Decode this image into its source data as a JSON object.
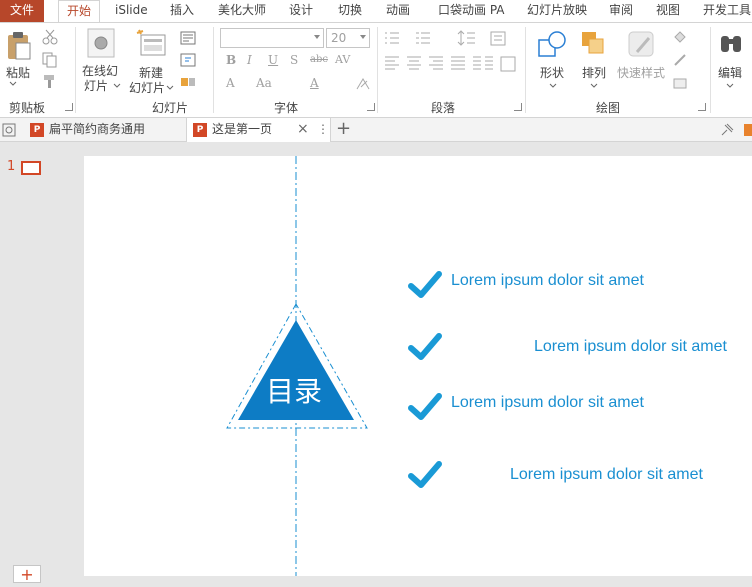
{
  "menu": {
    "file": "文件",
    "tabs": [
      "开始",
      "iSlide",
      "插入",
      "美化大师",
      "设计",
      "切换",
      "动画",
      "口袋动画 PA",
      "幻灯片放映",
      "审阅",
      "视图",
      "开发工具"
    ]
  },
  "ribbon": {
    "clipboard": {
      "paste": "粘贴",
      "label": "剪贴板"
    },
    "slides": {
      "online": "在线幻",
      "online2": "灯片",
      "new": "新建",
      "new2": "幻灯片",
      "label": "幻灯片"
    },
    "font": {
      "size": "20",
      "label": "字体",
      "bold": "B",
      "italic": "I",
      "underline": "U",
      "shadow": "S",
      "strike": "abc",
      "spacing": "AV",
      "grow": "A",
      "case": "Aa",
      "fontcolor": "A"
    },
    "paragraph": {
      "label": "段落"
    },
    "drawing": {
      "shapes": "形状",
      "arrange": "排列",
      "quickstyle": "快速样式",
      "label": "绘图"
    },
    "editing": {
      "edit": "编辑"
    }
  },
  "docs": {
    "tab1": "扁平简约商务通用",
    "tab2": "这是第一页"
  },
  "thumbs": {
    "number": "1",
    "add": "+"
  },
  "slide": {
    "title": "目录",
    "items": [
      "Lorem ipsum dolor sit amet",
      "Lorem ipsum dolor sit amet",
      "Lorem ipsum dolor sit amet",
      "Lorem ipsum dolor sit amet"
    ]
  },
  "colors": {
    "accent": "#b7472a",
    "blue": "#1a8fd1",
    "check": "#1a9ad6"
  }
}
